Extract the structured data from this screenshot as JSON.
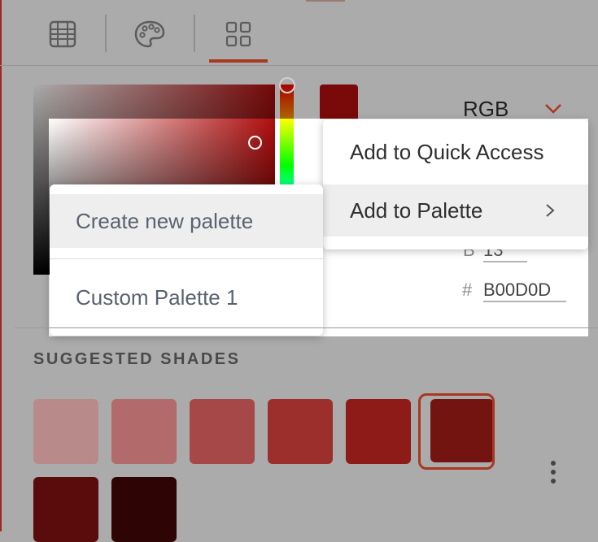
{
  "tabs": [
    {
      "name": "grid-tab",
      "icon": "table-grid-icon"
    },
    {
      "name": "palette-tab",
      "icon": "paint-palette-icon"
    },
    {
      "name": "apps-tab",
      "icon": "four-squares-icon",
      "active": true
    }
  ],
  "picker": {
    "mode": "RGB",
    "b_label": "B",
    "b_value": "13",
    "hex_label": "#",
    "hex_value": "B00D0D",
    "current_color": "#7a0909"
  },
  "context_menu": {
    "items": [
      {
        "label": "Add to Quick Access"
      },
      {
        "label": "Add to Palette",
        "has_submenu": true
      }
    ]
  },
  "submenu": {
    "items": [
      {
        "label": "Create new palette"
      },
      {
        "label": "Custom Palette 1"
      }
    ]
  },
  "shades": {
    "title": "SUGGESTED SHADES",
    "colors": [
      "#b88a8a",
      "#b26a6a",
      "#a64848",
      "#9c2f2b",
      "#8f1b18",
      "#731410",
      "#5a0b0b",
      "#2e0404"
    ],
    "selected_index": 5
  },
  "colors": {
    "accent": "#a8381f"
  }
}
